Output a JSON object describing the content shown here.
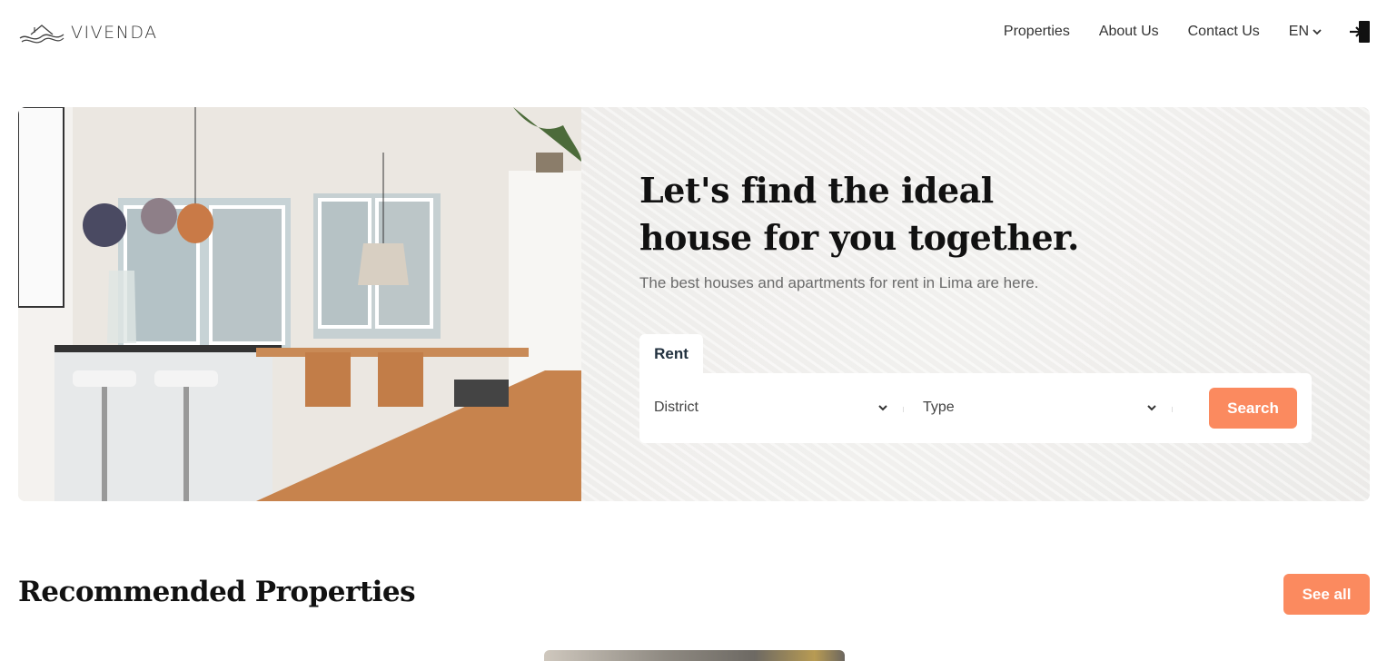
{
  "header": {
    "logo_text": "VIVENDA",
    "nav": [
      "Properties",
      "About Us",
      "Contact Us"
    ],
    "language": "EN",
    "icons": {
      "logo": "house-wave-logo-icon",
      "lang": "chevron-down-icon",
      "login": "login-door-icon"
    }
  },
  "hero": {
    "title_line1": "Let's find the ideal",
    "title_line2": "house for you together.",
    "subtitle": "The best houses and apartments for rent in Lima are here.",
    "tab": "Rent",
    "district_placeholder": "District",
    "type_placeholder": "Type",
    "search_label": "Search",
    "image": "kitchen-dining-room-photo"
  },
  "recommended": {
    "title": "Recommended Properties",
    "see_all_label": "See all"
  },
  "colors": {
    "accent": "#fb8a5f",
    "text_dark": "#111111",
    "subtitle": "#6b6b6b",
    "hero_bg": "#f3f2f0"
  }
}
